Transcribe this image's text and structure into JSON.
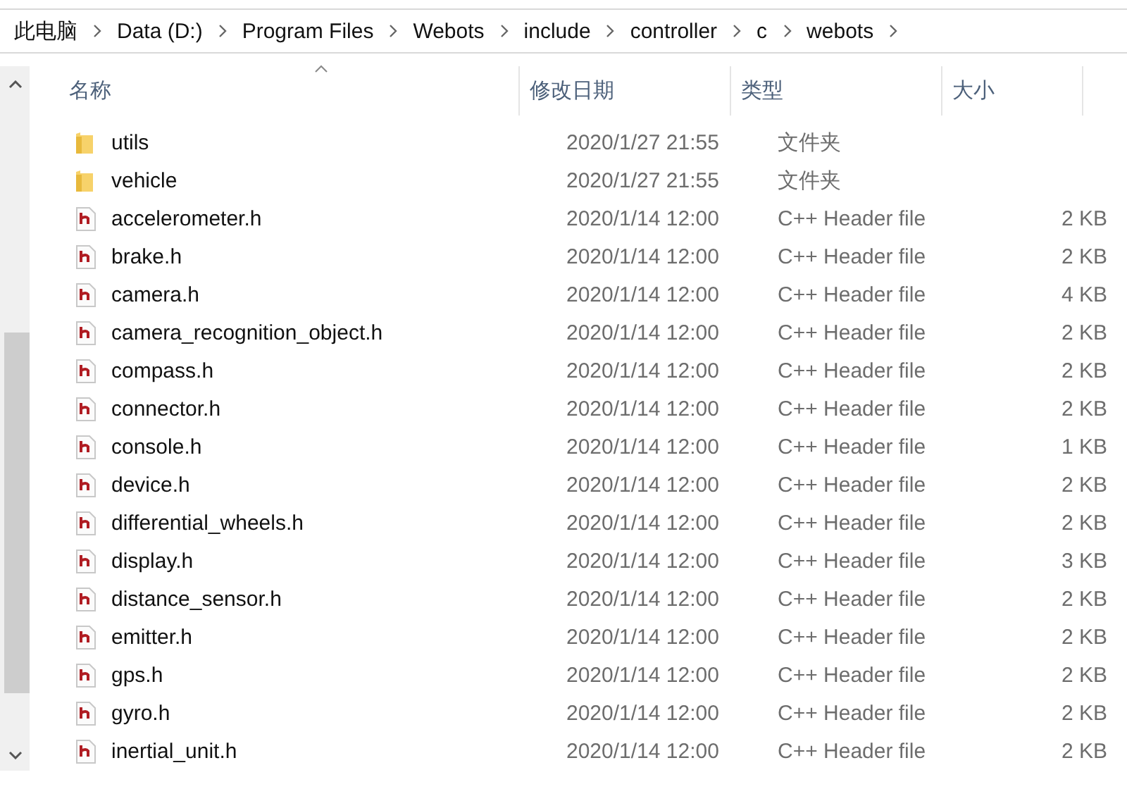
{
  "breadcrumb": [
    "此电脑",
    "Data (D:)",
    "Program Files",
    "Webots",
    "include",
    "controller",
    "c",
    "webots"
  ],
  "columns": [
    {
      "label": "名称",
      "sorted": true
    },
    {
      "label": "修改日期",
      "sorted": false
    },
    {
      "label": "类型",
      "sorted": false
    },
    {
      "label": "大小",
      "sorted": false
    }
  ],
  "rows": [
    {
      "kind": "folder",
      "name": "utils",
      "date": "2020/1/27 21:55",
      "type": "文件夹"
    },
    {
      "kind": "folder",
      "name": "vehicle",
      "date": "2020/1/27 21:55",
      "type": "文件夹"
    },
    {
      "kind": "header",
      "name": "accelerometer.h",
      "date": "2020/1/14 12:00",
      "type": "C++ Header file",
      "size": "2 KB"
    },
    {
      "kind": "header",
      "name": "brake.h",
      "date": "2020/1/14 12:00",
      "type": "C++ Header file",
      "size": "2 KB"
    },
    {
      "kind": "header",
      "name": "camera.h",
      "date": "2020/1/14 12:00",
      "type": "C++ Header file",
      "size": "4 KB"
    },
    {
      "kind": "header",
      "name": "camera_recognition_object.h",
      "date": "2020/1/14 12:00",
      "type": "C++ Header file",
      "size": "2 KB"
    },
    {
      "kind": "header",
      "name": "compass.h",
      "date": "2020/1/14 12:00",
      "type": "C++ Header file",
      "size": "2 KB"
    },
    {
      "kind": "header",
      "name": "connector.h",
      "date": "2020/1/14 12:00",
      "type": "C++ Header file",
      "size": "2 KB"
    },
    {
      "kind": "header",
      "name": "console.h",
      "date": "2020/1/14 12:00",
      "type": "C++ Header file",
      "size": "1 KB"
    },
    {
      "kind": "header",
      "name": "device.h",
      "date": "2020/1/14 12:00",
      "type": "C++ Header file",
      "size": "2 KB"
    },
    {
      "kind": "header",
      "name": "differential_wheels.h",
      "date": "2020/1/14 12:00",
      "type": "C++ Header file",
      "size": "2 KB"
    },
    {
      "kind": "header",
      "name": "display.h",
      "date": "2020/1/14 12:00",
      "type": "C++ Header file",
      "size": "3 KB"
    },
    {
      "kind": "header",
      "name": "distance_sensor.h",
      "date": "2020/1/14 12:00",
      "type": "C++ Header file",
      "size": "2 KB"
    },
    {
      "kind": "header",
      "name": "emitter.h",
      "date": "2020/1/14 12:00",
      "type": "C++ Header file",
      "size": "2 KB"
    },
    {
      "kind": "header",
      "name": "gps.h",
      "date": "2020/1/14 12:00",
      "type": "C++ Header file",
      "size": "2 KB"
    },
    {
      "kind": "header",
      "name": "gyro.h",
      "date": "2020/1/14 12:00",
      "type": "C++ Header file",
      "size": "2 KB"
    },
    {
      "kind": "header",
      "name": "inertial_unit.h",
      "date": "2020/1/14 12:00",
      "type": "C++ Header file",
      "size": "2 KB"
    }
  ]
}
